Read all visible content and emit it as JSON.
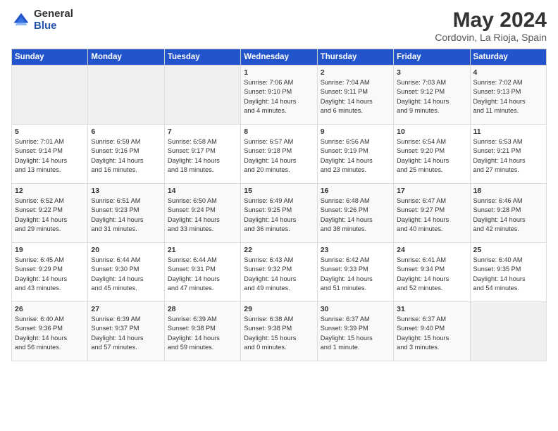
{
  "header": {
    "logo_general": "General",
    "logo_blue": "Blue",
    "title": "May 2024",
    "subtitle": "Cordovin, La Rioja, Spain"
  },
  "columns": [
    "Sunday",
    "Monday",
    "Tuesday",
    "Wednesday",
    "Thursday",
    "Friday",
    "Saturday"
  ],
  "weeks": [
    [
      {
        "day": "",
        "info": ""
      },
      {
        "day": "",
        "info": ""
      },
      {
        "day": "",
        "info": ""
      },
      {
        "day": "1",
        "info": "Sunrise: 7:06 AM\nSunset: 9:10 PM\nDaylight: 14 hours\nand 4 minutes."
      },
      {
        "day": "2",
        "info": "Sunrise: 7:04 AM\nSunset: 9:11 PM\nDaylight: 14 hours\nand 6 minutes."
      },
      {
        "day": "3",
        "info": "Sunrise: 7:03 AM\nSunset: 9:12 PM\nDaylight: 14 hours\nand 9 minutes."
      },
      {
        "day": "4",
        "info": "Sunrise: 7:02 AM\nSunset: 9:13 PM\nDaylight: 14 hours\nand 11 minutes."
      }
    ],
    [
      {
        "day": "5",
        "info": "Sunrise: 7:01 AM\nSunset: 9:14 PM\nDaylight: 14 hours\nand 13 minutes."
      },
      {
        "day": "6",
        "info": "Sunrise: 6:59 AM\nSunset: 9:16 PM\nDaylight: 14 hours\nand 16 minutes."
      },
      {
        "day": "7",
        "info": "Sunrise: 6:58 AM\nSunset: 9:17 PM\nDaylight: 14 hours\nand 18 minutes."
      },
      {
        "day": "8",
        "info": "Sunrise: 6:57 AM\nSunset: 9:18 PM\nDaylight: 14 hours\nand 20 minutes."
      },
      {
        "day": "9",
        "info": "Sunrise: 6:56 AM\nSunset: 9:19 PM\nDaylight: 14 hours\nand 23 minutes."
      },
      {
        "day": "10",
        "info": "Sunrise: 6:54 AM\nSunset: 9:20 PM\nDaylight: 14 hours\nand 25 minutes."
      },
      {
        "day": "11",
        "info": "Sunrise: 6:53 AM\nSunset: 9:21 PM\nDaylight: 14 hours\nand 27 minutes."
      }
    ],
    [
      {
        "day": "12",
        "info": "Sunrise: 6:52 AM\nSunset: 9:22 PM\nDaylight: 14 hours\nand 29 minutes."
      },
      {
        "day": "13",
        "info": "Sunrise: 6:51 AM\nSunset: 9:23 PM\nDaylight: 14 hours\nand 31 minutes."
      },
      {
        "day": "14",
        "info": "Sunrise: 6:50 AM\nSunset: 9:24 PM\nDaylight: 14 hours\nand 33 minutes."
      },
      {
        "day": "15",
        "info": "Sunrise: 6:49 AM\nSunset: 9:25 PM\nDaylight: 14 hours\nand 36 minutes."
      },
      {
        "day": "16",
        "info": "Sunrise: 6:48 AM\nSunset: 9:26 PM\nDaylight: 14 hours\nand 38 minutes."
      },
      {
        "day": "17",
        "info": "Sunrise: 6:47 AM\nSunset: 9:27 PM\nDaylight: 14 hours\nand 40 minutes."
      },
      {
        "day": "18",
        "info": "Sunrise: 6:46 AM\nSunset: 9:28 PM\nDaylight: 14 hours\nand 42 minutes."
      }
    ],
    [
      {
        "day": "19",
        "info": "Sunrise: 6:45 AM\nSunset: 9:29 PM\nDaylight: 14 hours\nand 43 minutes."
      },
      {
        "day": "20",
        "info": "Sunrise: 6:44 AM\nSunset: 9:30 PM\nDaylight: 14 hours\nand 45 minutes."
      },
      {
        "day": "21",
        "info": "Sunrise: 6:44 AM\nSunset: 9:31 PM\nDaylight: 14 hours\nand 47 minutes."
      },
      {
        "day": "22",
        "info": "Sunrise: 6:43 AM\nSunset: 9:32 PM\nDaylight: 14 hours\nand 49 minutes."
      },
      {
        "day": "23",
        "info": "Sunrise: 6:42 AM\nSunset: 9:33 PM\nDaylight: 14 hours\nand 51 minutes."
      },
      {
        "day": "24",
        "info": "Sunrise: 6:41 AM\nSunset: 9:34 PM\nDaylight: 14 hours\nand 52 minutes."
      },
      {
        "day": "25",
        "info": "Sunrise: 6:40 AM\nSunset: 9:35 PM\nDaylight: 14 hours\nand 54 minutes."
      }
    ],
    [
      {
        "day": "26",
        "info": "Sunrise: 6:40 AM\nSunset: 9:36 PM\nDaylight: 14 hours\nand 56 minutes."
      },
      {
        "day": "27",
        "info": "Sunrise: 6:39 AM\nSunset: 9:37 PM\nDaylight: 14 hours\nand 57 minutes."
      },
      {
        "day": "28",
        "info": "Sunrise: 6:39 AM\nSunset: 9:38 PM\nDaylight: 14 hours\nand 59 minutes."
      },
      {
        "day": "29",
        "info": "Sunrise: 6:38 AM\nSunset: 9:38 PM\nDaylight: 15 hours\nand 0 minutes."
      },
      {
        "day": "30",
        "info": "Sunrise: 6:37 AM\nSunset: 9:39 PM\nDaylight: 15 hours\nand 1 minute."
      },
      {
        "day": "31",
        "info": "Sunrise: 6:37 AM\nSunset: 9:40 PM\nDaylight: 15 hours\nand 3 minutes."
      },
      {
        "day": "",
        "info": ""
      }
    ]
  ]
}
